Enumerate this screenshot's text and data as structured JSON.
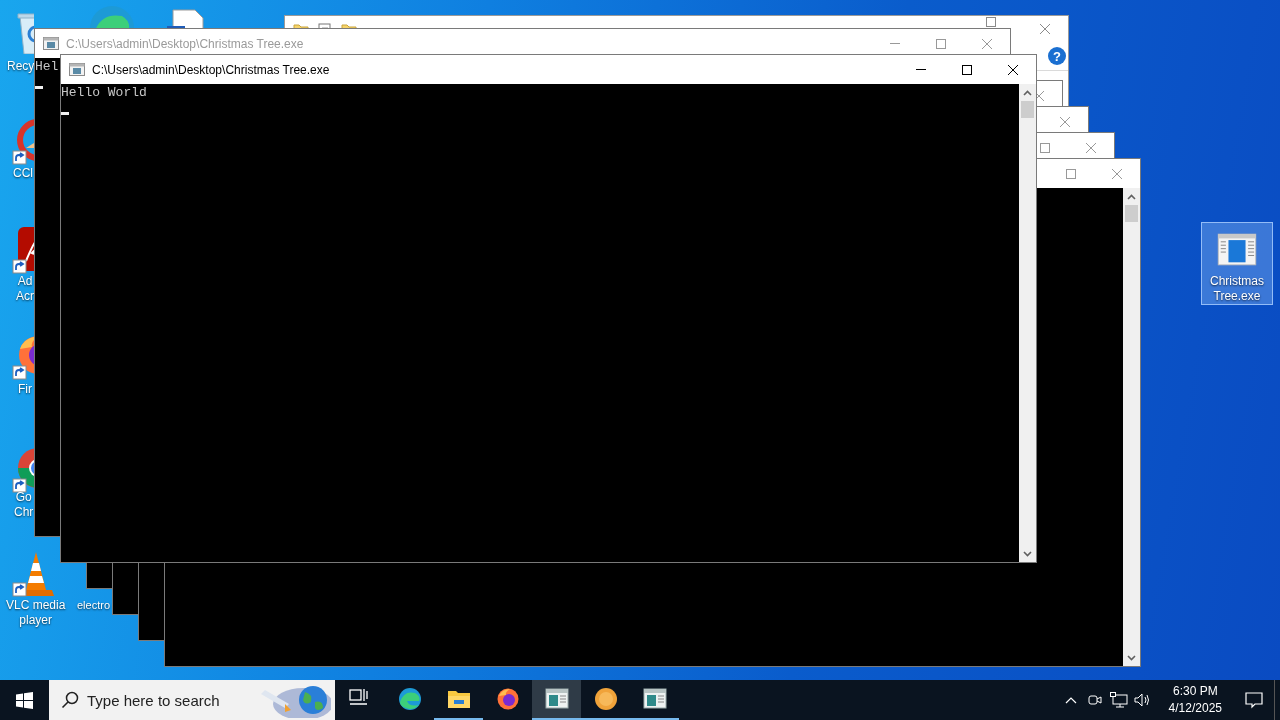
{
  "desktop": {
    "icons": [
      {
        "kind": "recycle",
        "label_lines": [
          "Recy"
        ],
        "selected": false
      },
      {
        "kind": "edge",
        "selected": false
      },
      {
        "kind": "document",
        "selected": false
      },
      {
        "kind": "ccleaner",
        "label_lines": [
          "CCl"
        ],
        "selected": false
      },
      {
        "kind": "acrobat",
        "label_lines": [
          "Ad",
          "Acr"
        ],
        "selected": false
      },
      {
        "kind": "firefox",
        "label_lines": [
          "Fir"
        ],
        "selected": false
      },
      {
        "kind": "chrome",
        "label_lines": [
          "Go",
          "Chr"
        ],
        "selected": false
      },
      {
        "kind": "vlc",
        "label_lines": [
          "VLC media",
          "player"
        ],
        "selected": false
      },
      {
        "kind": "hidden",
        "label_lines": [
          "electro"
        ],
        "selected": false
      },
      {
        "kind": "program",
        "label_lines": [
          "Christmas",
          "Tree.exe"
        ],
        "selected": true
      }
    ]
  },
  "windows": [
    {
      "kind": "explorer",
      "help": "?"
    },
    {
      "kind": "console"
    },
    {
      "kind": "console"
    },
    {
      "kind": "console"
    },
    {
      "kind": "console"
    },
    {
      "kind": "console",
      "title": "C:\\Users\\admin\\Desktop\\Christmas Tree.exe",
      "active": false,
      "lines": [
        "Hel"
      ],
      "cursor": true
    },
    {
      "kind": "console",
      "title": "C:\\Users\\admin\\Desktop\\Christmas Tree.exe",
      "active": true,
      "lines": [
        "Hello World"
      ],
      "cursor": true
    }
  ],
  "taskbar": {
    "search": {
      "placeholder": "Type here to search"
    },
    "apps": [
      {
        "kind": "task-view",
        "running": false,
        "selected": false
      },
      {
        "kind": "edge",
        "running": false,
        "selected": false
      },
      {
        "kind": "folder",
        "running": true,
        "selected": false
      },
      {
        "kind": "firefox",
        "running": false,
        "selected": false
      },
      {
        "kind": "console",
        "running": true,
        "selected": true
      },
      {
        "kind": "orange",
        "running": true,
        "selected": false
      },
      {
        "kind": "console",
        "running": true,
        "selected": false
      }
    ],
    "tray": {
      "time": "6:30 PM",
      "date": "4/12/2025"
    }
  }
}
